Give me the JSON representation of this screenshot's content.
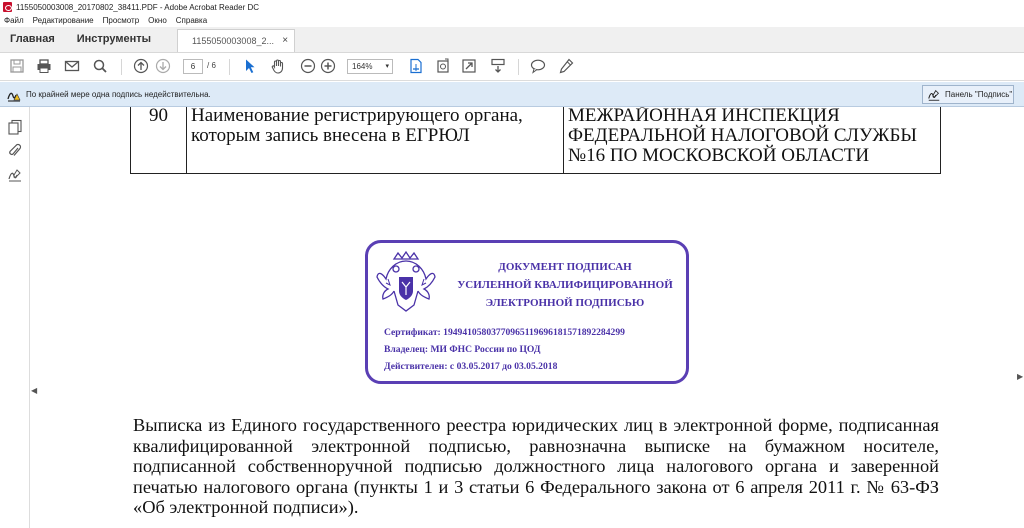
{
  "window": {
    "title": "1155050003008_20170802_38411.PDF - Adobe Acrobat Reader DC"
  },
  "menu": [
    "Файл",
    "Редактирование",
    "Просмотр",
    "Окно",
    "Справка"
  ],
  "tabs": {
    "home": "Главная",
    "tools": "Инструменты",
    "document": "1155050003008_2...",
    "close": "×"
  },
  "toolbar": {
    "page_current": "6",
    "page_sep": "/",
    "page_total": "6",
    "zoom": "164%",
    "zoom_arrow": "▾"
  },
  "infobar": {
    "message": "По крайней мере одна подпись недействительна.",
    "panel_button": "Панель \"Подпись\""
  },
  "document": {
    "row": {
      "number": "90",
      "label": "Наименование регистрирующего органа, которым запись внесена в ЕГРЮЛ",
      "value_lines": [
        "МЕЖРАЙОННАЯ ИНСПЕКЦИЯ",
        "ФЕДЕРАЛЬНОЙ НАЛОГОВОЙ СЛУЖБЫ",
        "№16 ПО МОСКОВСКОЙ ОБЛАСТИ"
      ]
    },
    "stamp": {
      "header_lines": [
        "ДОКУМЕНТ ПОДПИСАН",
        "УСИЛЕННОЙ КВАЛИФИЦИРОВАННОЙ",
        "ЭЛЕКТРОННОЙ ПОДПИСЬЮ"
      ],
      "certificate": "Сертификат: 194941058037709651196961815718922842​99",
      "owner": "Владелец: МИ ФНС России по ЦОД",
      "valid": "Действителен: с 03.05.2017 до 03.05.2018"
    },
    "paragraph": "Выписка из Единого государственного реестра юридических лиц в электронной форме, подписанная квалифицированной электронной подписью, равнозначна выписке на бумажном носителе, подписанной собственноручной подписью должностного лица налогового органа и заверенной печатью налогового органа (пункты 1 и 3 статьи 6 Федерального закона от 6 апреля 2011 г. № 63-ФЗ «Об электронной подписи»)."
  },
  "colors": {
    "stamp": "#4a32a8",
    "infobar_bg": "#ddeaf7",
    "accent_blue": "#1a6fd1"
  },
  "icons": [
    "save-icon",
    "print-icon",
    "email-icon",
    "search-icon",
    "page-up-icon",
    "page-down-icon",
    "select-cursor-icon",
    "hand-icon",
    "zoom-out-icon",
    "zoom-in-icon",
    "fit-page-icon",
    "rotate-icon",
    "fullscreen-icon",
    "scroll-mode-icon",
    "comment-icon",
    "highlight-pen-icon",
    "signature-warning-icon",
    "pages-icon",
    "attachment-icon",
    "signature-icon"
  ]
}
